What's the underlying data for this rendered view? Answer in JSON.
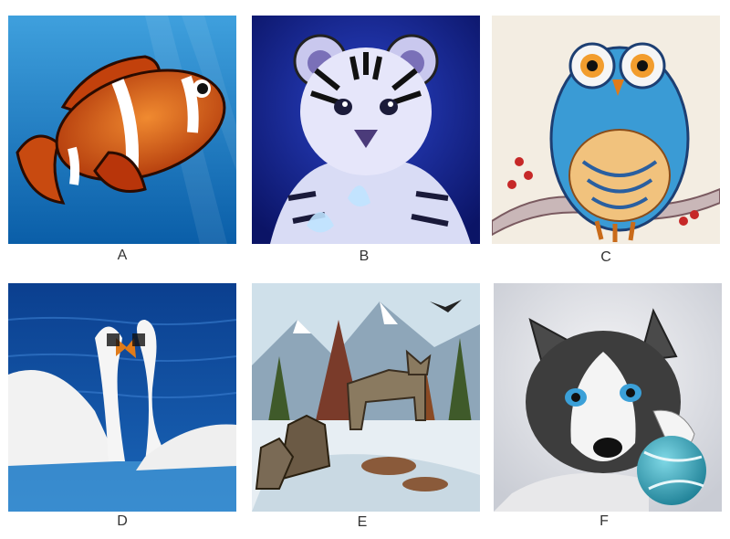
{
  "options": [
    {
      "label": "A",
      "subject": "clownfish-painting"
    },
    {
      "label": "B",
      "subject": "tiger-cub-painting"
    },
    {
      "label": "C",
      "subject": "owl-painting"
    },
    {
      "label": "D",
      "subject": "swans-painting"
    },
    {
      "label": "E",
      "subject": "wolves-painting"
    },
    {
      "label": "F",
      "subject": "husky-puppy-painting"
    }
  ]
}
